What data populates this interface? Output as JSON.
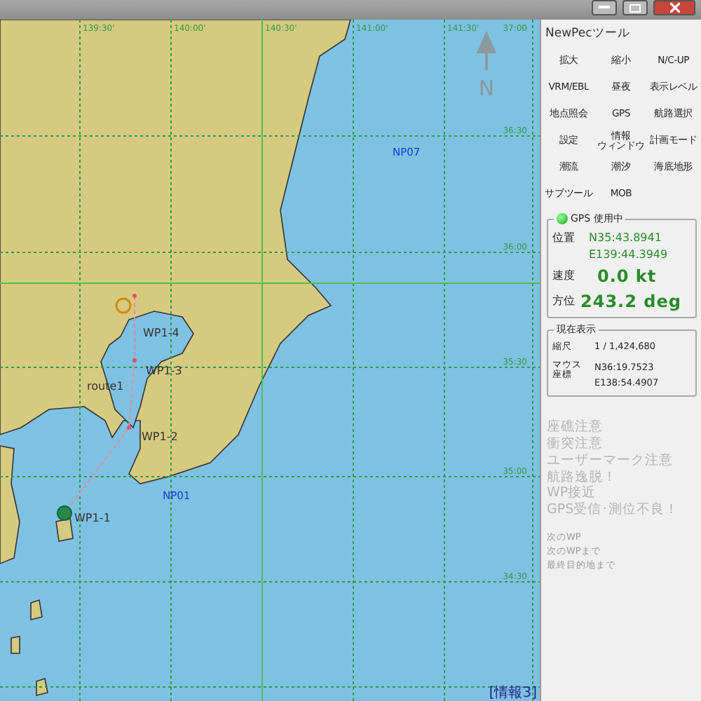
{
  "chart": {
    "longitude_labels": [
      "139:30'",
      "140:00'",
      "140:30'",
      "141:00'",
      "141:30'"
    ],
    "latitude_labels": [
      "37:00",
      "36:30",
      "36:00",
      "35:30",
      "35:00",
      "34:30"
    ],
    "north_label": "N",
    "route": {
      "name": "route1",
      "waypoints": [
        {
          "label": "WP1-4",
          "selected": false
        },
        {
          "label": "WP1-3",
          "selected": false
        },
        {
          "label": "WP1-2",
          "selected": false
        },
        {
          "label": "WP1-1",
          "selected": true
        }
      ]
    },
    "marks": [
      {
        "label": "NP07"
      },
      {
        "label": "NP01"
      }
    ],
    "info_label": "[情報3]"
  },
  "tool_panel": {
    "title": "NewPecツール",
    "buttons": [
      "拡大",
      "縮小",
      "N/C-UP",
      "VRM/EBL",
      "昼夜",
      "表示レベル",
      "地点照会",
      "GPS",
      "航路選択",
      "設定",
      [
        "情報",
        "ウィンドウ"
      ],
      "計画モード",
      "潮流",
      "潮汐",
      "海底地形",
      "サブツール",
      "MOB"
    ]
  },
  "gps": {
    "title": "GPS 使用中",
    "on": true,
    "position_label": "位置",
    "latitude": "N35:43.8941",
    "longitude": "E139:44.3949",
    "speed_label": "速度",
    "speed": "0.0 kt",
    "heading_label": "方位",
    "heading": "243.2 deg"
  },
  "display": {
    "title": "現在表示",
    "scale_label": "縮尺",
    "scale": "1 / 1,424,680",
    "mouse_label": [
      "マウス",
      "座標"
    ],
    "mouse_latitude": "N36:19.7523",
    "mouse_longitude": "E138:54.4907"
  },
  "alerts": [
    {
      "text": "座礁注意",
      "active": false
    },
    {
      "text": "衝突注意",
      "active": false
    },
    {
      "text": "ユーザーマーク注意",
      "active": false
    },
    {
      "text": "航路逸脱！",
      "active": false
    },
    {
      "text": "WP接近",
      "active": false
    },
    {
      "text": "GPS受信･測位不良！",
      "active": false
    }
  ],
  "next_info": [
    "次のWP",
    "次のWPまで",
    "最終目的地まで"
  ]
}
